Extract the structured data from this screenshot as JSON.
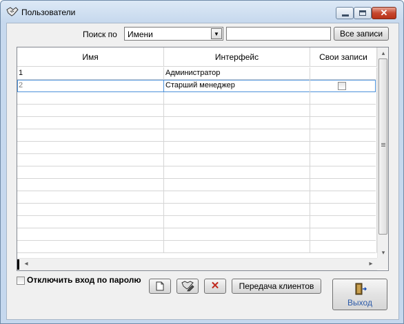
{
  "window": {
    "title": "Пользователи",
    "minimize_icon": "minimize-icon",
    "maximize_icon": "maximize-icon",
    "close_icon": "close-icon",
    "close_glyph": "✕"
  },
  "search": {
    "label": "Поиск по",
    "field_value": "Имени",
    "dropdown_arrow": "▼",
    "text_value": "",
    "all_records_label": "Все записи"
  },
  "table": {
    "columns": [
      "Имя",
      "Интерфейс",
      "Свои записи"
    ],
    "rows": [
      {
        "name": "1",
        "interface": "Администратор",
        "own_records": null
      },
      {
        "name": "2",
        "interface": "Старший менеджер",
        "own_records": false
      }
    ],
    "empty_row_count": 13,
    "selected_row": 1,
    "scroll_left_glyph": "◂",
    "scroll_right_glyph": "▸",
    "scroll_up_glyph": "▴",
    "scroll_down_glyph": "▾"
  },
  "footer": {
    "disable_password_label": "Отключить вход по паролю",
    "disable_password_checked": false,
    "new_icon": "new-document-icon",
    "edit_icon": "edit-user-icon",
    "delete_icon": "delete-x-icon",
    "delete_glyph": "✕",
    "transfer_clients_label": "Передача клиентов",
    "exit_label": "Выход",
    "exit_icon": "exit-door-icon"
  },
  "colors": {
    "accent": "#2c5aa8",
    "selection_border": "#4a90d9",
    "delete_red": "#c0281e"
  }
}
